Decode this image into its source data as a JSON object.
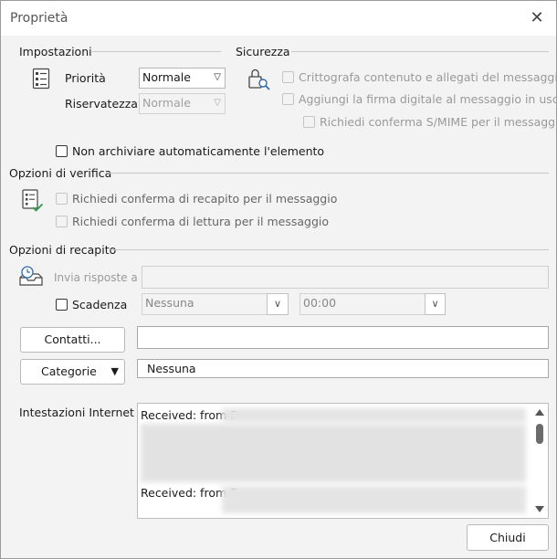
{
  "window": {
    "title": "Proprietà"
  },
  "impostazioni": {
    "heading": "Impostazioni",
    "priorita_label": "Priorità",
    "priorita_value": "Normale",
    "riservatezza_label": "Riservatezza",
    "riservatezza_value": "Normale"
  },
  "sicurezza": {
    "heading": "Sicurezza",
    "cripto": "Crittografa contenuto e allegati del messaggio",
    "firma": "Aggiungi la firma digitale al messaggio in uscita",
    "smime": "Richiedi conferma S/MIME per il messaggio"
  },
  "non_archiviare": "Non archiviare automaticamente l'elemento",
  "verifica": {
    "heading": "Opzioni di verifica",
    "recapito": "Richiedi conferma di recapito per il messaggio",
    "lettura": "Richiedi conferma di lettura per il messaggio"
  },
  "recapito": {
    "heading": "Opzioni di recapito",
    "invia_label": "Invia risposte a",
    "scadenza_label": "Scadenza",
    "scadenza_date": "Nessuna",
    "scadenza_time": "00:00"
  },
  "contatti_button": "Contatti...",
  "categorie_button": "Categorie",
  "categorie_value": "Nessuna",
  "intestazioni": {
    "label": "Intestazioni Internet",
    "line1": "Received: from F",
    "line2": "Received: from E"
  },
  "chiudi_button": "Chiudi"
}
